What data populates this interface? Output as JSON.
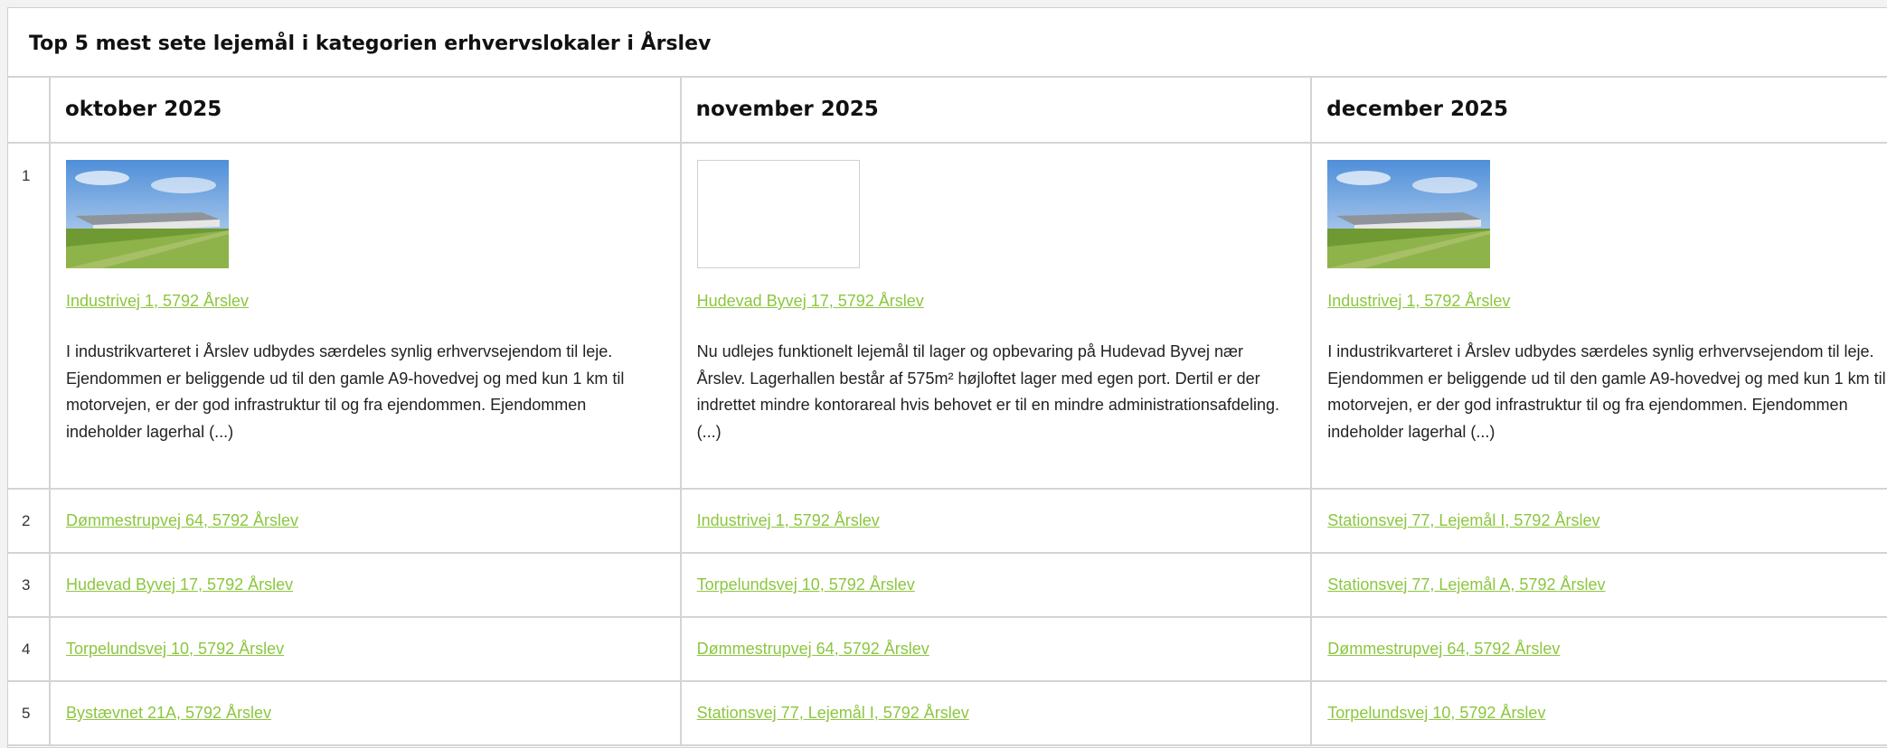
{
  "title": "Top 5 mest sete lejemål i kategorien erhvervslokaler i Årslev",
  "months": [
    "oktober 2025",
    "november 2025",
    "december 2025"
  ],
  "rows": [
    {
      "rank": "1",
      "cells": [
        {
          "address": "Industrivej 1, 5792 Årslev",
          "has_image": true,
          "description": "I industrikvarteret i Årslev udbydes særdeles synlig erhvervsejendom til leje. Ejendommen er beliggende ud til den gamle A9-hovedvej og med kun 1 km til motorvejen, er der god infrastruktur til og fra ejendommen. Ejendommen indeholder lagerhal (...)"
        },
        {
          "address": "Hudevad Byvej 17, 5792 Årslev",
          "has_image": false,
          "description": "Nu udlejes funktionelt lejemål til lager og opbevaring på Hudevad Byvej nær Årslev. Lagerhallen består af 575m² højloftet lager med egen port. Dertil er der indrettet mindre kontorareal hvis behovet er til en mindre administrationsafdeling. (...)"
        },
        {
          "address": "Industrivej 1, 5792 Årslev",
          "has_image": true,
          "description": "I industrikvarteret i Årslev udbydes særdeles synlig erhvervsejendom til leje. Ejendommen er beliggende ud til den gamle A9-hovedvej og med kun 1 km til motorvejen, er der god infrastruktur til og fra ejendommen. Ejendommen indeholder lagerhal (...)"
        }
      ]
    },
    {
      "rank": "2",
      "cells": [
        {
          "address": "Dømmestrupvej 64, 5792 Årslev"
        },
        {
          "address": "Industrivej 1, 5792 Årslev"
        },
        {
          "address": "Stationsvej 77, Lejemål I, 5792 Årslev"
        }
      ]
    },
    {
      "rank": "3",
      "cells": [
        {
          "address": "Hudevad Byvej 17, 5792 Årslev"
        },
        {
          "address": "Torpelundsvej 10, 5792 Årslev"
        },
        {
          "address": "Stationsvej 77, Lejemål A, 5792 Årslev"
        }
      ]
    },
    {
      "rank": "4",
      "cells": [
        {
          "address": "Torpelundsvej 10, 5792 Årslev"
        },
        {
          "address": "Dømmestrupvej 64, 5792 Årslev"
        },
        {
          "address": "Dømmestrupvej 64, 5792 Årslev"
        }
      ]
    },
    {
      "rank": "5",
      "cells": [
        {
          "address": "Bystævnet 21A, 5792 Årslev"
        },
        {
          "address": "Stationsvej 77, Lejemål I, 5792 Årslev"
        },
        {
          "address": "Torpelundsvej 10, 5792 Årslev"
        }
      ]
    }
  ],
  "colors": {
    "link": "#8cc63f",
    "border": "#d4d4d4"
  }
}
